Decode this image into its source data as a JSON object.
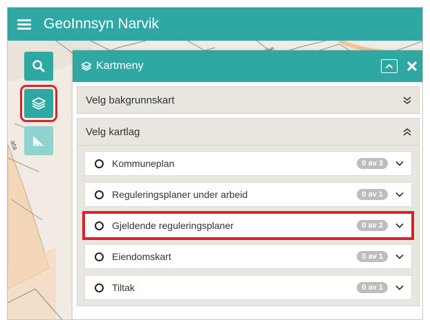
{
  "app": {
    "title": "GeoInnsyn Narvik"
  },
  "icons": {
    "menu": "hamburger-icon",
    "search": "search-icon",
    "layers": "layers-icon",
    "measure": "measure-icon",
    "collapse": "chevron-up-icon",
    "close": "close-icon"
  },
  "colors": {
    "accent": "#2fa8a3",
    "accent_light": "#8fd2ce",
    "highlight": "#d8232a",
    "badge": "#bdbdbd"
  },
  "map": {
    "street_label": "strive",
    "side_label": "ata"
  },
  "panel": {
    "title": "Kartmeny",
    "sections": [
      {
        "label": "Velg bakgrunnskart",
        "expanded": false
      },
      {
        "label": "Velg kartlag",
        "expanded": true
      }
    ],
    "layers": [
      {
        "label": "Kommuneplan",
        "badge": "0 av 3"
      },
      {
        "label": "Reguleringsplaner under arbeid",
        "badge": "0 av 1"
      },
      {
        "label": "Gjeldende reguleringsplaner",
        "badge": "0 av 2",
        "highlighted": true
      },
      {
        "label": "Eiendomskart",
        "badge": "0 av 1"
      },
      {
        "label": "Tiltak",
        "badge": "0 av 1"
      }
    ]
  }
}
